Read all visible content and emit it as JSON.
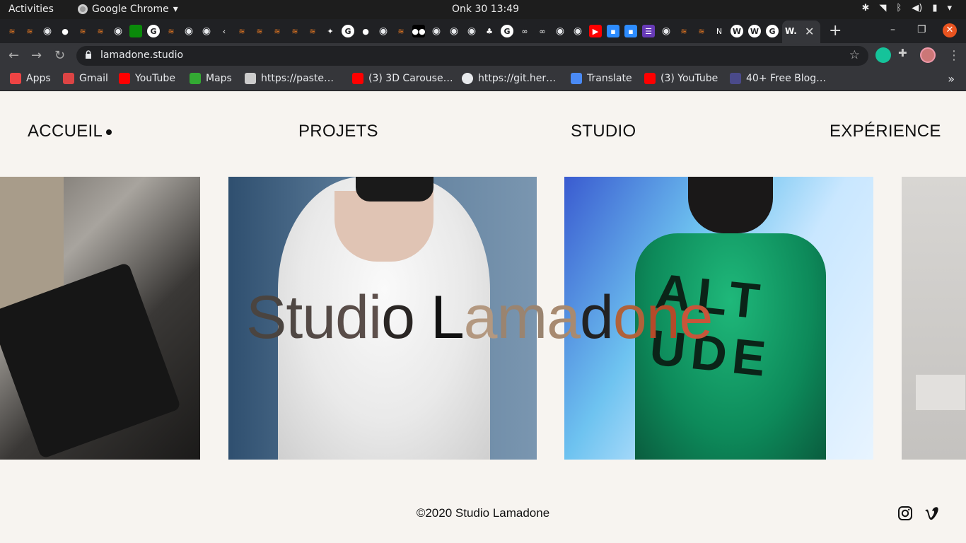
{
  "os_bar": {
    "activities": "Activities",
    "app_name": "Google Chrome",
    "clock": "Onk 30  13:49"
  },
  "browser": {
    "url": "lamadone.studio",
    "active_tab_favicon": "W.",
    "tab_favicons": [
      "stackoverflow",
      "stackoverflow",
      "globe",
      "github",
      "stackoverflow",
      "stackoverflow",
      "globe",
      "green-square",
      "google",
      "stackoverflow",
      "globe",
      "globe",
      "code",
      "stackoverflow",
      "stackoverflow",
      "stackoverflow",
      "stackoverflow",
      "stackoverflow",
      "figma",
      "google",
      "github",
      "globe",
      "stackoverflow",
      "medium",
      "globe",
      "globe",
      "globe",
      "tree",
      "google",
      "codeshare",
      "codeshare",
      "globe",
      "globe",
      "youtube",
      "zoom",
      "zoom",
      "forms",
      "globe",
      "stackoverflow",
      "stackoverflow",
      "notion",
      "wix",
      "wix",
      "google"
    ]
  },
  "bookmarks": [
    {
      "label": "Apps",
      "icon": "apps-grid-icon"
    },
    {
      "label": "Gmail",
      "icon": "gmail-icon"
    },
    {
      "label": "YouTube",
      "icon": "youtube-icon"
    },
    {
      "label": "Maps",
      "icon": "maps-icon"
    },
    {
      "label": "https://paste…",
      "icon": "pastebin-icon"
    },
    {
      "label": "(3) 3D Carouse…",
      "icon": "youtube-icon"
    },
    {
      "label": "https://git.her…",
      "icon": "globe-icon"
    },
    {
      "label": "Translate",
      "icon": "translate-icon"
    },
    {
      "label": "(3) YouTube",
      "icon": "youtube-icon"
    },
    {
      "label": "40+ Free Blog…",
      "icon": "w3schools-icon"
    }
  ],
  "site": {
    "nav": [
      {
        "label": "ACCUEIL",
        "active": true
      },
      {
        "label": "PROJETS",
        "active": false
      },
      {
        "label": "STUDIO",
        "active": false
      },
      {
        "label": "EXPÉRIENCE",
        "active": false
      }
    ],
    "hero_title": "Studio Lamadone",
    "hero_title_letter_colors": [
      "#4a4440",
      "#4f4743",
      "#544a46",
      "#594d49",
      "#5e504c",
      "#2a2624",
      "#111111",
      "#b39880",
      "#9a8470",
      "#a88a70",
      "#222222",
      "#b0623a",
      "#b54a2a",
      "#c8553a",
      "#e8405a"
    ],
    "footer": "©2020 Studio Lamadone",
    "social": [
      "instagram-icon",
      "vimeo-icon"
    ]
  }
}
